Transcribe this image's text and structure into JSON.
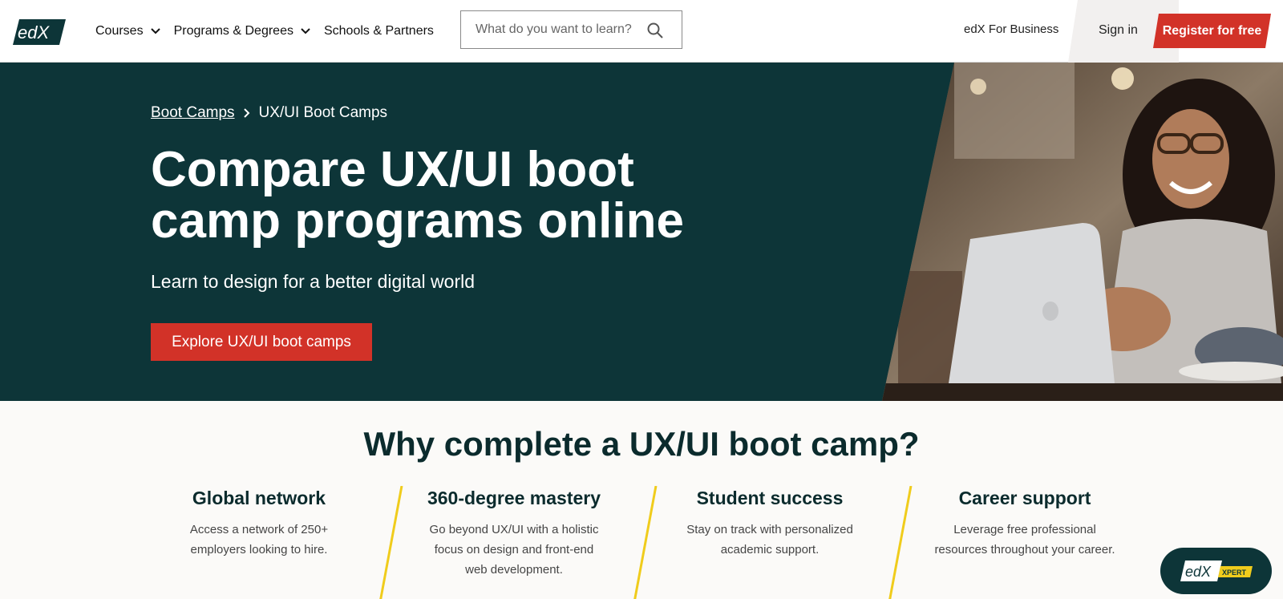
{
  "header": {
    "logo_text": "edX",
    "nav": [
      {
        "label": "Courses",
        "has_dropdown": true
      },
      {
        "label": "Programs & Degrees",
        "has_dropdown": true
      },
      {
        "label": "Schools & Partners",
        "has_dropdown": false
      }
    ],
    "search": {
      "placeholder": "What do you want to learn?",
      "value": ""
    },
    "business_label": "edX For Business",
    "signin_label": "Sign in",
    "register_label": "Register for free"
  },
  "hero": {
    "breadcrumb": {
      "parent": "Boot Camps",
      "current": "UX/UI Boot Camps"
    },
    "title_line1": "Compare UX/UI boot",
    "title_line2": "camp programs online",
    "subtitle": "Learn to design for a better digital world",
    "cta_label": "Explore UX/UI boot camps"
  },
  "why": {
    "title": "Why complete a UX/UI boot camp?",
    "features": [
      {
        "title": "Global network",
        "description": "Access a network of 250+ employers looking to hire."
      },
      {
        "title": "360-degree mastery",
        "description": "Go beyond UX/UI with a holistic focus on design and front-end web development."
      },
      {
        "title": "Student success",
        "description": "Stay on track with personalized academic support."
      },
      {
        "title": "Career support",
        "description": "Leverage free professional resources throughout your career."
      }
    ]
  },
  "xpert": {
    "logo_text": "edX",
    "badge_text": "XPERT"
  },
  "colors": {
    "brand_red": "#d23228",
    "hero_bg": "#0d3538",
    "divider_yellow": "#f0cc1c"
  }
}
